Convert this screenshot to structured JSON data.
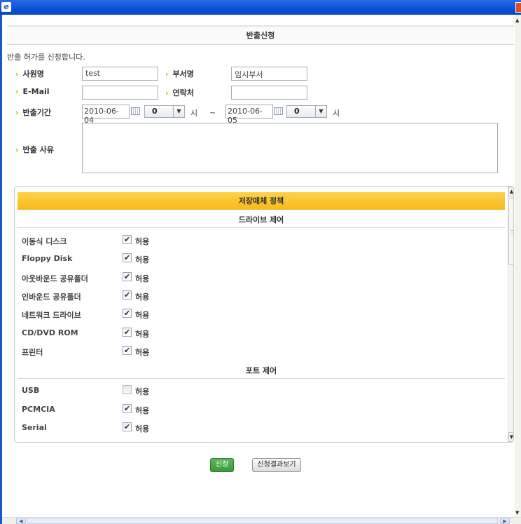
{
  "window": {
    "ie_glyph": "e"
  },
  "page": {
    "title": "반출신청",
    "intro": "반출 허가를 신청합니다."
  },
  "form": {
    "user_label": "사원명",
    "user_value": "test",
    "dept_label": "부서명",
    "dept_value": "임시부서",
    "email_label": "E-Mail",
    "email_value": "",
    "phone_label": "연락처",
    "phone_value": "",
    "period_label": "반출기간",
    "start_date": "2010-06-04",
    "start_hour": "0",
    "hour_unit": "시",
    "tilde": "~",
    "end_date": "2010-06-05",
    "end_hour": "0",
    "reason_label": "반출 사유",
    "arrow": "›"
  },
  "policy": {
    "title": "저장매체 정책",
    "drive_section": "드라이브 제어",
    "port_section": "포트 제어",
    "allow_label": "허용",
    "drives": [
      {
        "name": "이동식 디스크",
        "checked": true
      },
      {
        "name": "Floppy Disk",
        "checked": true
      },
      {
        "name": "아웃바운드 공유폴더",
        "checked": true
      },
      {
        "name": "인바운드 공유폴더",
        "checked": true
      },
      {
        "name": "네트워크 드라이브",
        "checked": true
      },
      {
        "name": "CD/DVD ROM",
        "checked": true
      },
      {
        "name": "프린터",
        "checked": true
      }
    ],
    "ports": [
      {
        "name": "USB",
        "checked": false
      },
      {
        "name": "PCMCIA",
        "checked": true
      },
      {
        "name": "Serial",
        "checked": true
      }
    ]
  },
  "buttons": {
    "apply": "신청",
    "result": "신청결과보기"
  },
  "icons": {
    "check": "✔",
    "dropdown": "▼",
    "up": "▲",
    "down": "▼",
    "left": "◀",
    "right": "▶"
  }
}
